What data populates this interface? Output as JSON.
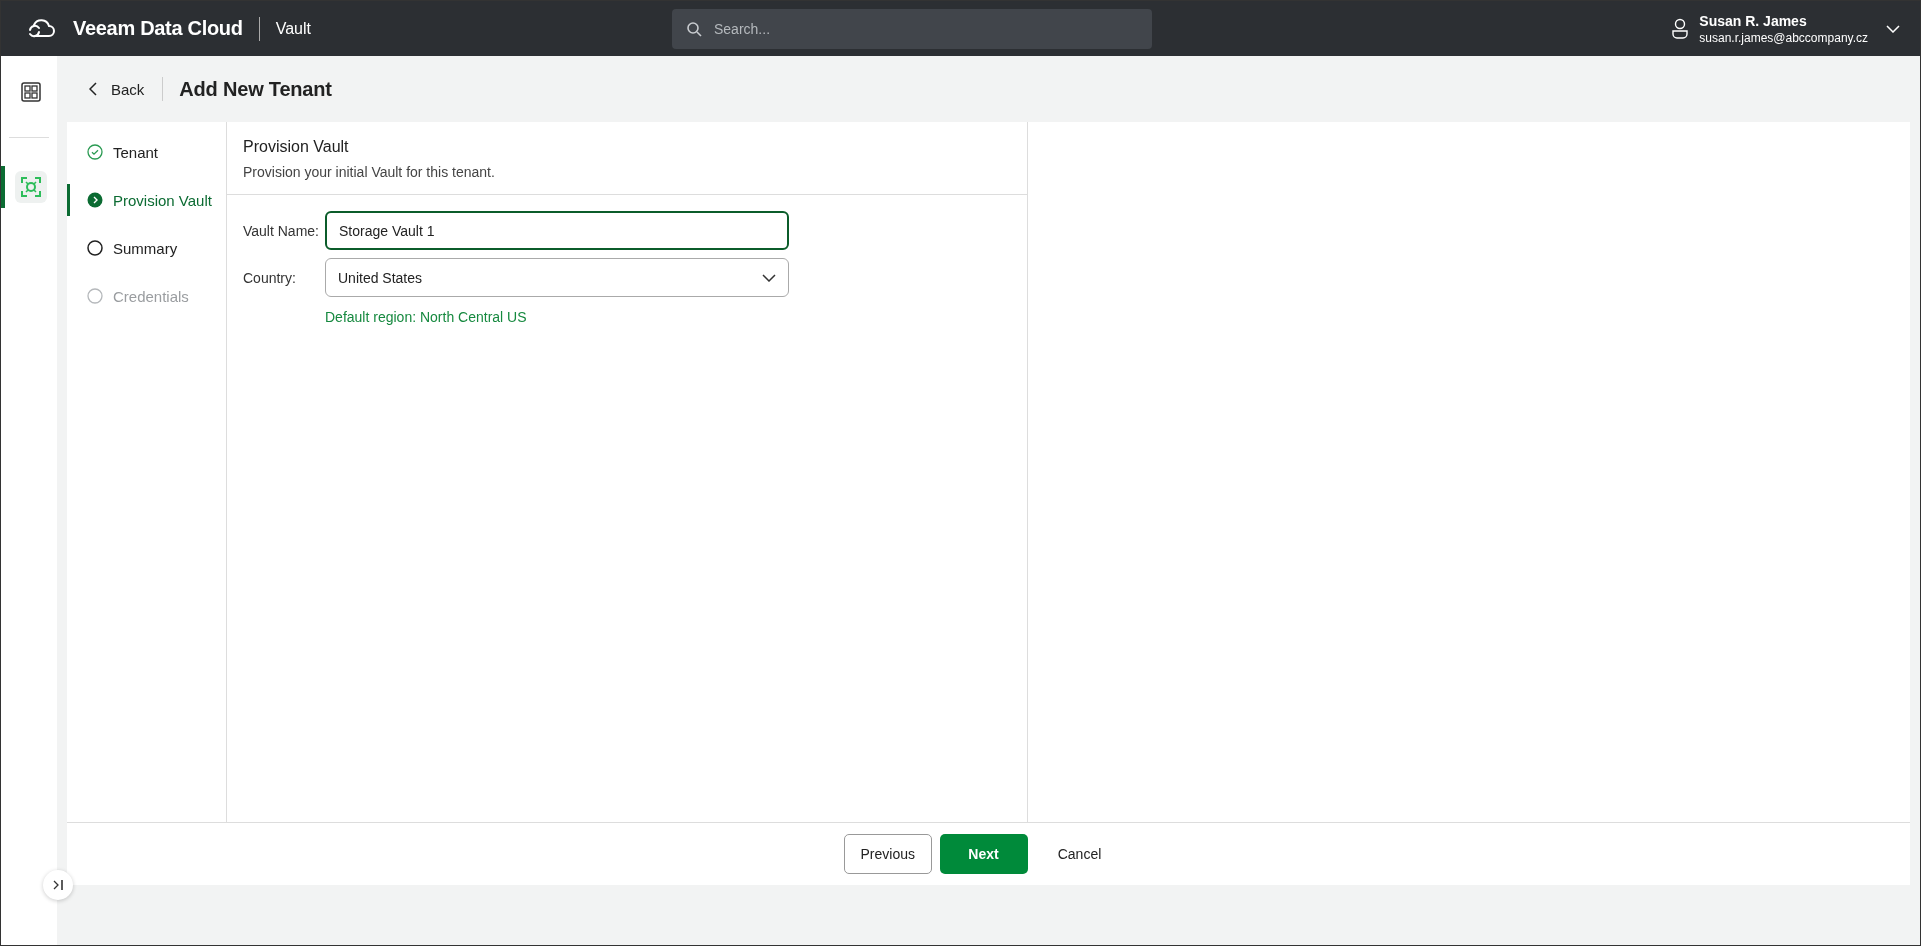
{
  "top_bar": {
    "brand": "Veeam Data Cloud",
    "product": "Vault",
    "search": {
      "placeholder": "Search..."
    },
    "user": {
      "name": "Susan R. James",
      "email": "susan.r.james@abccompany.cz"
    }
  },
  "rail": {
    "items": [
      {
        "kind": "dashboard",
        "selected": false
      },
      {
        "kind": "vault",
        "selected": true
      }
    ]
  },
  "header": {
    "back": "Back",
    "title": "Add New Tenant"
  },
  "steps": [
    {
      "label": "Tenant",
      "kind": "done",
      "selected": false
    },
    {
      "label": "Provision Vault",
      "kind": "current",
      "selected": true
    },
    {
      "label": "Summary",
      "kind": "pending",
      "selected": false
    },
    {
      "label": "Credentials",
      "kind": "disabled",
      "selected": false
    }
  ],
  "section": {
    "title": "Provision Vault",
    "description": "Provision your initial Vault for this tenant."
  },
  "form": {
    "fields": [
      {
        "kind": "text",
        "label": "Vault Name:",
        "value": "Storage Vault 1",
        "focused": true
      },
      {
        "kind": "select",
        "label": "Country:",
        "value": "United States",
        "focused": false,
        "hint": "Default region: North Central US"
      }
    ]
  },
  "footer": {
    "buttons": [
      {
        "kind": "secondary",
        "label": "Previous"
      },
      {
        "kind": "primary",
        "label": "Next"
      },
      {
        "kind": "link",
        "label": "Cancel"
      }
    ]
  }
}
